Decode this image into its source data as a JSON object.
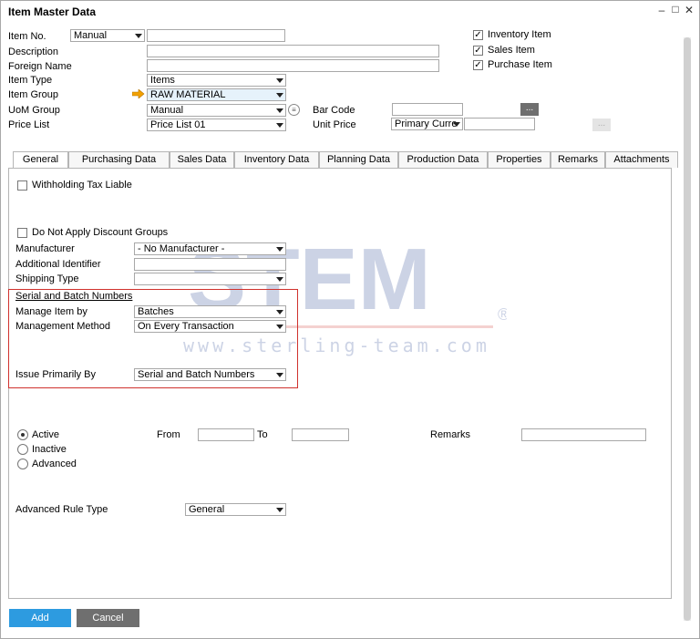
{
  "window": {
    "title": "Item Master Data"
  },
  "header": {
    "item_no": {
      "label": "Item No.",
      "series": "Manual",
      "value": ""
    },
    "description": {
      "label": "Description",
      "value": ""
    },
    "foreign_name": {
      "label": "Foreign Name",
      "value": ""
    },
    "item_type": {
      "label": "Item Type",
      "value": "Items"
    },
    "item_group": {
      "label": "Item Group",
      "value": "RAW MATERIAL"
    },
    "uom_group": {
      "label": "UoM Group",
      "value": "Manual"
    },
    "bar_code": {
      "label": "Bar Code",
      "value": ""
    },
    "price_list": {
      "label": "Price List",
      "value": "Price List 01"
    },
    "unit_price": {
      "label": "Unit Price",
      "currency": "Primary Curre",
      "value": ""
    },
    "checks": [
      {
        "label": "Inventory Item",
        "checked": true
      },
      {
        "label": "Sales Item",
        "checked": true
      },
      {
        "label": "Purchase Item",
        "checked": true
      }
    ],
    "dots_label": "..."
  },
  "tabs": [
    "General",
    "Purchasing Data",
    "Sales Data",
    "Inventory Data",
    "Planning Data",
    "Production Data",
    "Properties",
    "Remarks",
    "Attachments"
  ],
  "active_tab": "General",
  "general": {
    "withholding": "Withholding Tax Liable",
    "no_discount": "Do Not Apply Discount Groups",
    "manufacturer": {
      "label": "Manufacturer",
      "value": "- No Manufacturer -"
    },
    "additional_identifier": {
      "label": "Additional Identifier",
      "value": ""
    },
    "shipping_type": {
      "label": "Shipping Type",
      "value": ""
    },
    "serial_batch_header": "Serial and Batch Numbers",
    "manage_item_by": {
      "label": "Manage Item by",
      "value": "Batches"
    },
    "management_method": {
      "label": "Management Method",
      "value": "On Every Transaction"
    },
    "issue_primarily_by": {
      "label": "Issue Primarily By",
      "value": "Serial and Batch Numbers"
    },
    "status_options": [
      {
        "label": "Active",
        "selected": true
      },
      {
        "label": "Inactive",
        "selected": false
      },
      {
        "label": "Advanced",
        "selected": false
      }
    ],
    "from_label": "From",
    "to_label": "To",
    "remarks_label": "Remarks",
    "advanced_rule_type": {
      "label": "Advanced Rule Type",
      "value": "General"
    }
  },
  "footer": {
    "add": "Add",
    "cancel": "Cancel"
  },
  "watermark": {
    "brand": "STEM",
    "url": "www.sterling-team.com"
  },
  "colors": {
    "add_button": "#2d9be0",
    "cancel_button": "#6f6f6f",
    "highlight_box": "#d0312d",
    "item_group_bg": "#e6f2fb"
  }
}
